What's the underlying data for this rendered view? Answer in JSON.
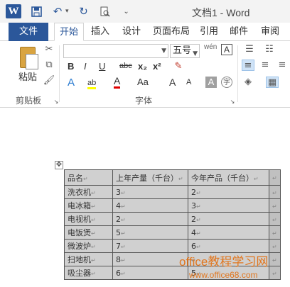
{
  "window": {
    "title": "文档1 - Word"
  },
  "qat": {
    "undo_arrow": "▾"
  },
  "tabs": [
    "文件",
    "开始",
    "插入",
    "设计",
    "页面布局",
    "引用",
    "邮件",
    "审阅"
  ],
  "ribbon": {
    "paste_label": "粘贴",
    "clipboard_label": "剪贴板",
    "font_label": "字体",
    "font_name": "",
    "font_size": "五号",
    "bold": "B",
    "italic": "I",
    "underline": "U",
    "strike": "abc",
    "subscript": "x₂",
    "superscript": "x²",
    "text_effect": "A",
    "highlight": "ab",
    "font_color": "A",
    "change_case": "Aa",
    "grow_font": "A",
    "shrink_font": "A",
    "char_shading": "A",
    "enclose": "字",
    "phonetic": "wén",
    "char_border": "A"
  },
  "table": {
    "headers": [
      "品名",
      "上年产量（千台）",
      "今年产品（千台）"
    ],
    "rows": [
      [
        "洗衣机",
        "3",
        "2"
      ],
      [
        "电冰箱",
        "4",
        "3"
      ],
      [
        "电视机",
        "2",
        "2"
      ],
      [
        "电饭煲",
        "5",
        "4"
      ],
      [
        "微波炉",
        "7",
        "6"
      ],
      [
        "扫地机",
        "8",
        ""
      ],
      [
        "吸尘器",
        "6",
        "5"
      ]
    ]
  },
  "watermark": {
    "text": "office教程学习网",
    "url": "www.office68.com"
  },
  "colors": {
    "accent": "#2b579a",
    "table_fill": "#d0d0d0",
    "watermark": "#e1761e"
  }
}
